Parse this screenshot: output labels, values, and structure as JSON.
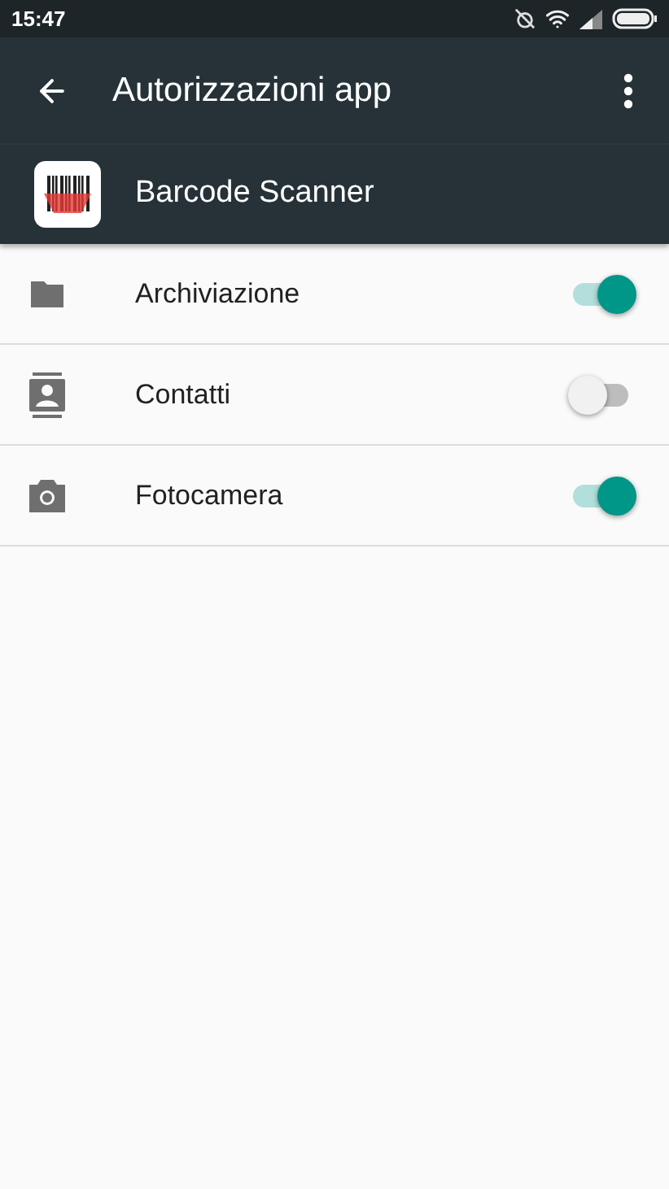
{
  "status_bar": {
    "time": "15:47"
  },
  "app_bar": {
    "title": "Autorizzazioni app"
  },
  "app": {
    "name": "Barcode Scanner"
  },
  "permissions": [
    {
      "kind": "storage",
      "label": "Archiviazione",
      "on": true
    },
    {
      "kind": "contacts",
      "label": "Contatti",
      "on": false
    },
    {
      "kind": "camera",
      "label": "Fotocamera",
      "on": true
    }
  ]
}
